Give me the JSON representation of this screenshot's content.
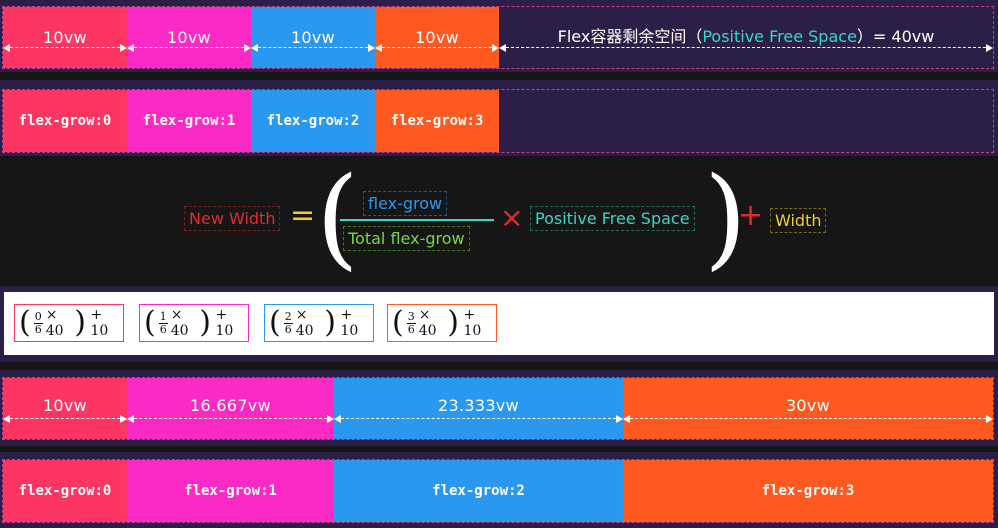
{
  "colors": {
    "red": "#fd3563",
    "pink": "#fb2ac4",
    "blue": "#2b98f0",
    "orange": "#fd5921",
    "container": "#2c1f47",
    "teal": "#38d7c9",
    "green": "#7bd63a",
    "yellow": "#f3cd32",
    "formula_red": "#e32b2b"
  },
  "row1": {
    "cells": [
      "10vw",
      "10vw",
      "10vw",
      "10vw"
    ],
    "free_space_prefix": "Flex容器剩余空间（",
    "free_space_highlight": "Positive Free Space",
    "free_space_suffix": "）= 40vw"
  },
  "row2": {
    "items": [
      "flex-grow:0",
      "flex-grow:1",
      "flex-grow:2",
      "flex-grow:3"
    ]
  },
  "formula": {
    "new_width": "New Width",
    "equals": "=",
    "numerator": "flex-grow",
    "denominator": "Total flex-grow",
    "times": "×",
    "free_space": "Positive Free Space",
    "plus": "+",
    "width": "Width"
  },
  "math": [
    {
      "num": "0",
      "den": "6",
      "times": "× 40",
      "plus": "+ 10"
    },
    {
      "num": "1",
      "den": "6",
      "times": "× 40",
      "plus": "+ 10"
    },
    {
      "num": "2",
      "den": "6",
      "times": "× 40",
      "plus": "+ 10"
    },
    {
      "num": "3",
      "den": "6",
      "times": "× 40",
      "plus": "+ 10"
    }
  ],
  "row5": {
    "cells": [
      "10vw",
      "16.667vw",
      "23.333vw",
      "30vw"
    ]
  },
  "row6": {
    "items": [
      "flex-grow:0",
      "flex-grow:1",
      "flex-grow:2",
      "flex-grow:3"
    ]
  }
}
